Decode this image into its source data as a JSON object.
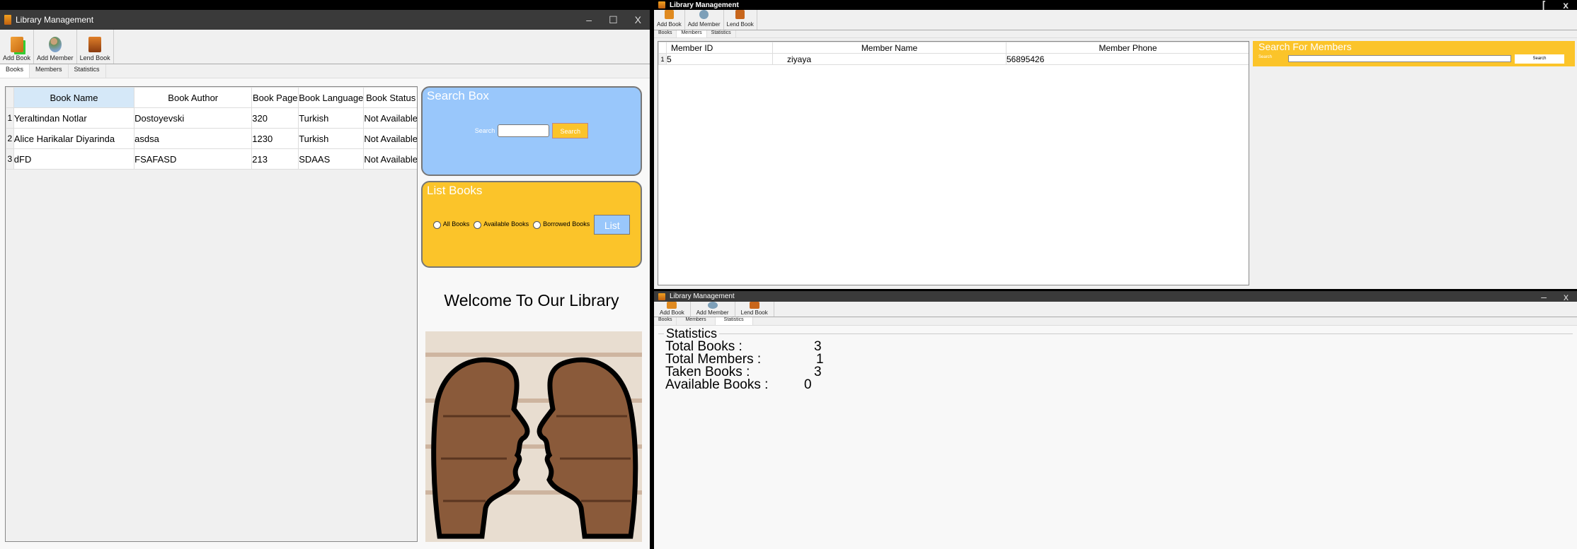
{
  "app_title": "Library Management",
  "toolbar": {
    "add_book": "Add Book",
    "add_member": "Add Member",
    "lend_book": "Lend Book"
  },
  "tabs": [
    "Books",
    "Members",
    "Statistics"
  ],
  "books": {
    "columns": [
      "Book Name",
      "Book Author",
      "Book Page",
      "Book Language",
      "Book Status"
    ],
    "rows": [
      {
        "n": "1",
        "name": "Yeraltindan Notlar",
        "author": "Dostoyevski",
        "page": "320",
        "lang": "Turkish",
        "status": "Not Available"
      },
      {
        "n": "2",
        "name": "Alice Harikalar Diyarinda",
        "author": "asdsa",
        "page": "1230",
        "lang": "Turkish",
        "status": "Not Available"
      },
      {
        "n": "3",
        "name": "dFD",
        "author": "FSAFASD",
        "page": "213",
        "lang": "SDAAS",
        "status": "Not Available"
      }
    ],
    "search_box": {
      "title": "Search Box",
      "label": "Search",
      "value": "",
      "button": "Search"
    },
    "list_books": {
      "title": "List Books",
      "options": [
        "All Books",
        "Available Books",
        "Borrowed Books"
      ],
      "button": "List"
    },
    "welcome": "Welcome To Our Library"
  },
  "members": {
    "columns": [
      "Member ID",
      "Member Name",
      "Member Phone"
    ],
    "rows": [
      {
        "n": "1",
        "id": "5",
        "name": "ziyaya",
        "phone": "56895426"
      }
    ],
    "search": {
      "title": "Search For Members",
      "label": "Search",
      "value": "",
      "button": "Search"
    }
  },
  "statistics": {
    "title": "Statistics",
    "items": [
      {
        "label": "Total Books :",
        "value": "3"
      },
      {
        "label": "Total Members :",
        "value": "1"
      },
      {
        "label": "Taken Books :",
        "value": "3"
      },
      {
        "label": "Available Books :",
        "value": "0"
      }
    ]
  },
  "colors": {
    "search_panel": "#99c7fb",
    "list_panel": "#fbc42a",
    "title_bar": "#3a3a3a"
  }
}
